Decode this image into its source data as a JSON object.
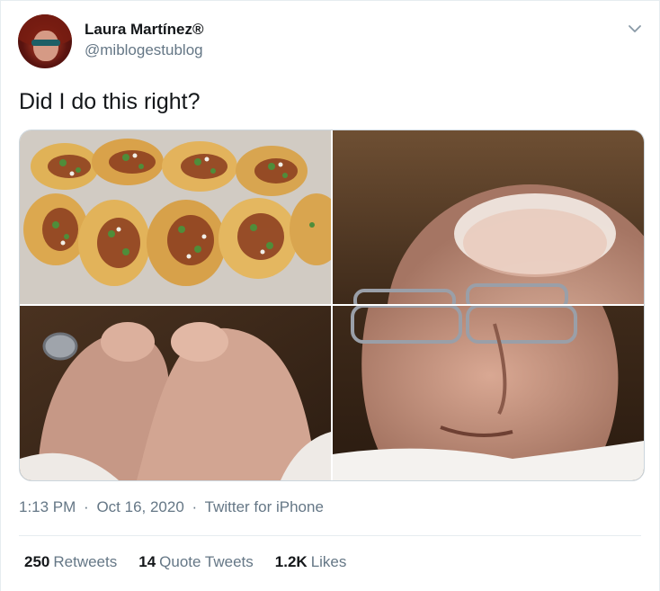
{
  "user": {
    "display_name": "Laura Martínez®",
    "handle": "@miblogestublog"
  },
  "tweet": {
    "text": "Did I do this right?"
  },
  "media": {
    "images": [
      "tacos-plate",
      "pope-forehead-glasses",
      "fingertips-pinch",
      "pope-eyes-closed"
    ]
  },
  "meta": {
    "time": "1:13 PM",
    "sep1": "·",
    "date": "Oct 16, 2020",
    "sep2": "·",
    "source": "Twitter for iPhone"
  },
  "stats": {
    "retweets_count": "250",
    "retweets_label": "Retweets",
    "quotes_count": "14",
    "quotes_label": "Quote Tweets",
    "likes_count": "1.2K",
    "likes_label": "Likes"
  },
  "icons": {
    "menu": "chevron-down-icon"
  }
}
